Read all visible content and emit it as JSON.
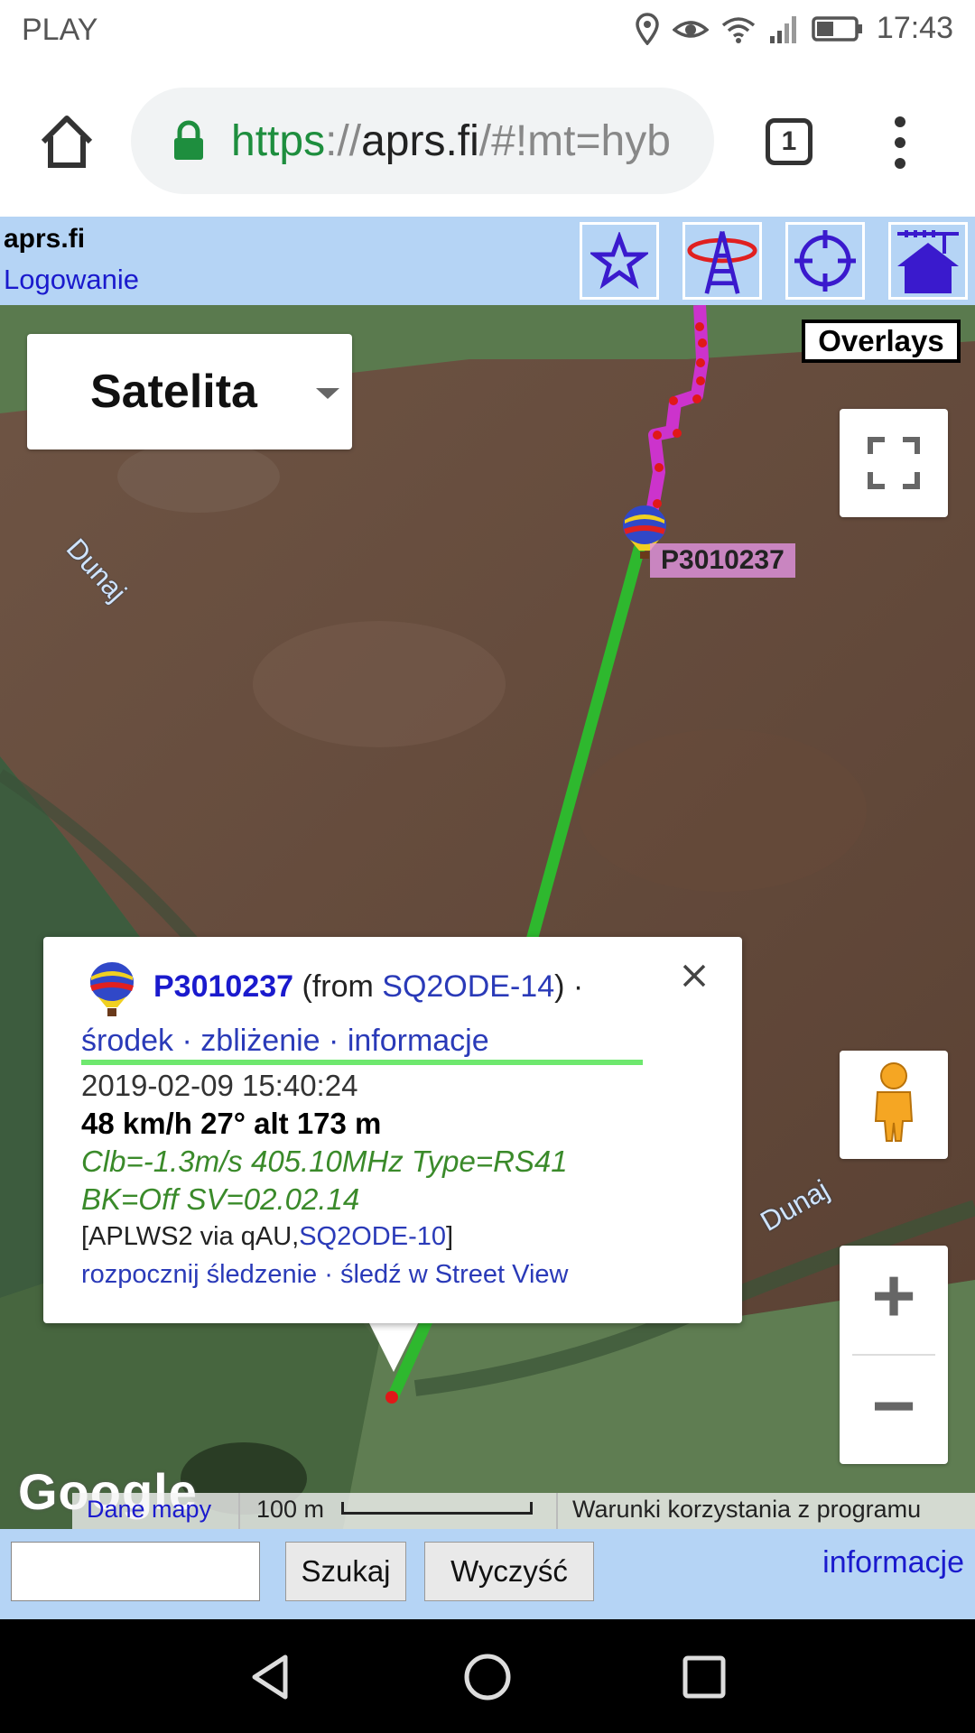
{
  "status_bar": {
    "carrier": "PLAY",
    "time": "17:43"
  },
  "browser": {
    "url_scheme": "https",
    "url_sep": "://",
    "url_host": "aprs.fi",
    "url_path": "/#!mt=hyb",
    "tab_count": "1"
  },
  "aprs_header": {
    "site_name": "aprs.fi",
    "login": "Logowanie"
  },
  "map": {
    "map_type": "Satelita",
    "overlays": "Overlays",
    "station_label": "P3010237",
    "river_labels": [
      "Dunaj",
      "Dunaj"
    ],
    "zoom_in": "+",
    "zoom_out": "−",
    "google": "Google",
    "attribution": {
      "map_data": "Dane mapy",
      "scale": "100 m",
      "terms": "Warunki korzystania z programu"
    }
  },
  "info_window": {
    "callsign": "P3010237",
    "from_prefix": " (from ",
    "from_station": "SQ2ODE-14",
    "from_suffix": ") ·",
    "link_center": "środek",
    "link_zoom": "zbliżenie",
    "link_info": "informacje",
    "sep": " · ",
    "timestamp": "2019-02-09 15:40:24",
    "speed_line": "48 km/h 27° alt 173 m",
    "comment_line1": "Clb=-1.3m/s 405.10MHz Type=RS41",
    "comment_line2": "BK=Off SV=02.02.14",
    "path_prefix": "[APLWS2 via qAU,",
    "path_station": "SQ2ODE-10",
    "path_suffix": "]",
    "action_track": "rozpocznij śledzenie",
    "action_streetview": "śledź w Street View"
  },
  "search_bar": {
    "input_value": "",
    "search_button": "Szukaj",
    "clear_button": "Wyczyść",
    "info_link": "informacje"
  },
  "colors": {
    "header_bg": "#b5d4f5",
    "link": "#1a1acd",
    "track_green": "#2eb82e",
    "track_magenta": "#cc33cc",
    "comment_green": "#3a8a2a"
  }
}
